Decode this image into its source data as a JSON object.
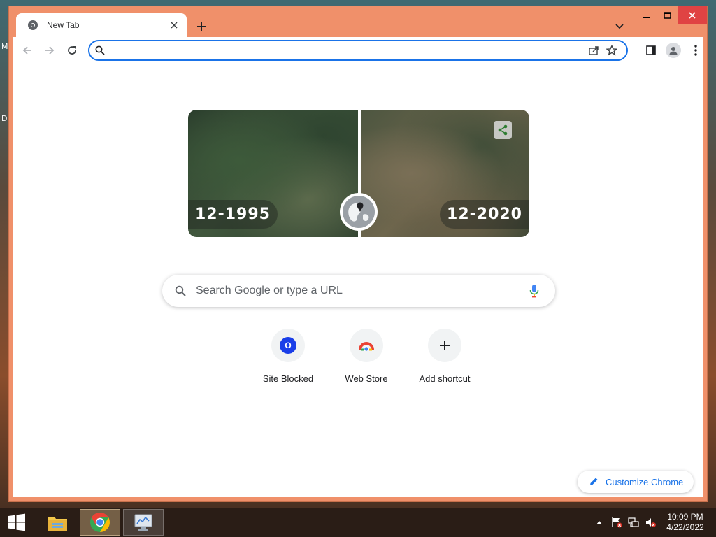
{
  "desktop": {
    "edge_letters": [
      "M",
      "D"
    ]
  },
  "browser": {
    "tab": {
      "title": "New Tab",
      "icon": "chrome-icon"
    },
    "omnibox": {
      "value": "",
      "placeholder": ""
    },
    "doodle": {
      "year_before": "12-1995",
      "year_after": "12-2020"
    },
    "search": {
      "placeholder": "Search Google or type a URL"
    },
    "shortcuts": [
      {
        "label": "Site Blocked",
        "icon_text": "O"
      },
      {
        "label": "Web Store"
      },
      {
        "label": "Add shortcut"
      }
    ],
    "customize_label": "Customize Chrome"
  },
  "taskbar": {
    "time": "10:09 PM",
    "date": "4/22/2022"
  },
  "colors": {
    "accent": "#1a73e8",
    "window_frame": "#f0906a",
    "close_button": "#e04343"
  }
}
